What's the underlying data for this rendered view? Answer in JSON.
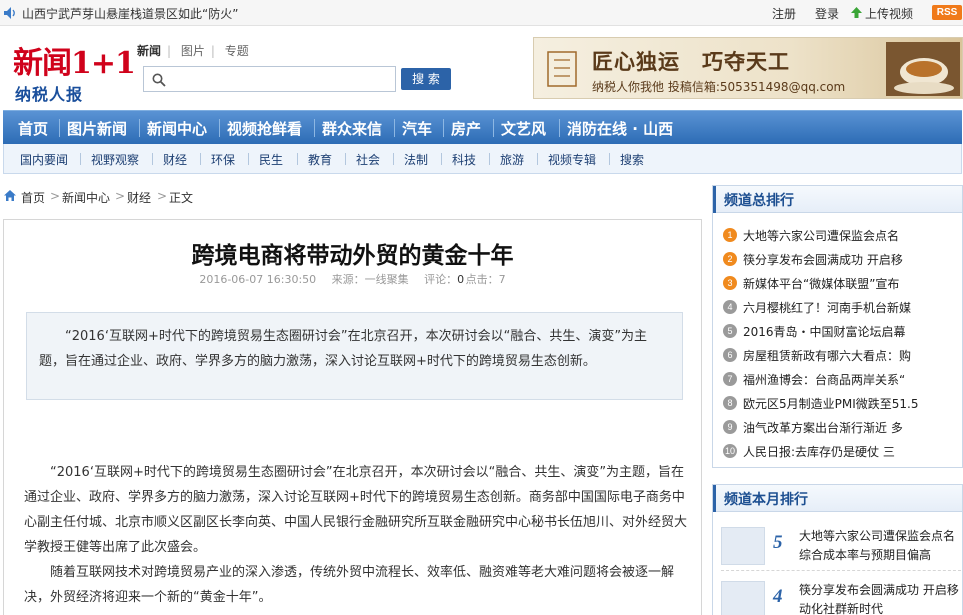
{
  "topbar": {
    "ticker": "山西宁武芦芽山悬崖栈道景区如此“防火”",
    "register": "注册",
    "login": "登录",
    "upload": "上传视频",
    "rss": "RSS"
  },
  "logo": {
    "main": "新闻1+1",
    "sub": "纳税人报"
  },
  "search": {
    "tabs": [
      "新闻",
      "图片",
      "专题"
    ],
    "active_tab": "新闻",
    "query": "",
    "button": "搜 索"
  },
  "banner": {
    "slogan": "匠心独运　巧夺天工",
    "contact": "纳税人你我他 投稿信箱:505351498@qq.com"
  },
  "nav_main": [
    "首页",
    "图片新闻",
    "新闻中心",
    "视频抢鲜看",
    "群众来信",
    "汽车",
    "房产",
    "文艺风",
    "消防在线 · 山西"
  ],
  "nav_sub": [
    "国内要闻",
    "视野观察",
    "财经",
    "环保",
    "民生",
    "教育",
    "社会",
    "法制",
    "科技",
    "旅游",
    "视频专辑",
    "搜索"
  ],
  "breadcrumb": [
    "首页",
    "新闻中心",
    "财经",
    "正文"
  ],
  "article": {
    "title": "跨境电商将带动外贸的黄金十年",
    "date": "2016-06-07 16:30:50",
    "source": "来源：一线聚集",
    "comments_label": "评论：",
    "comments": "0",
    "clicks_label": "点击：",
    "clicks": "7",
    "summary": "“2016‘互联网+时代下的跨境贸易生态圈研讨会”在北京召开，本次研讨会以“融合、共生、演变”为主题，旨在通过企业、政府、学界多方的脑力激荡，深入讨论互联网+时代下的跨境贸易生态创新。",
    "para1": "“2016‘互联网+时代下的跨境贸易生态圈研讨会”在北京召开，本次研讨会以“融合、共生、演变”为主题，旨在通过企业、政府、学界多方的脑力激荡，深入讨论互联网+时代下的跨境贸易生态创新。商务部中国国际电子商务中心副主任付城、北京市顺义区副区长李向英、中国人民银行金融研究所互联金融研究中心秘书长伍旭川、对外经贸大学教授王健等出席了此次盛会。",
    "para2": "随着互联网技术对跨境贸易产业的深入渗透，传统外贸中流程长、效率低、融资难等老大难问题将会被逐一解决，外贸经济将迎来一个新的“黄金十年”。"
  },
  "channel_rank": {
    "title": "频道总排行",
    "items": [
      {
        "num": "1",
        "text": "大地等六家公司遭保监会点名"
      },
      {
        "num": "2",
        "text": "筷分享发布会圆满成功 开启移"
      },
      {
        "num": "3",
        "text": "新媒体平台“微媒体联盟”宣布"
      },
      {
        "num": "4",
        "text": "六月樱桃红了！河南手机台新媒"
      },
      {
        "num": "5",
        "text": "2016青岛・中国财富论坛启幕"
      },
      {
        "num": "6",
        "text": "房屋租赁新政有哪六大看点：购"
      },
      {
        "num": "7",
        "text": "福州渔博会：台商品两岸关系“"
      },
      {
        "num": "8",
        "text": "欧元区5月制造业PMI微跌至51.5"
      },
      {
        "num": "9",
        "text": "油气改革方案出台渐行渐近 多"
      },
      {
        "num": "10",
        "text": "人民日报:去库存仍是硬仗 三"
      }
    ]
  },
  "month_rank": {
    "title": "频道本月排行",
    "items": [
      {
        "num": "5",
        "text": "大地等六家公司遭保监会点名 综合成本率与预期目偏高"
      },
      {
        "num": "4",
        "text": "筷分享发布会圆满成功 开启移动化社群新时代"
      }
    ]
  }
}
